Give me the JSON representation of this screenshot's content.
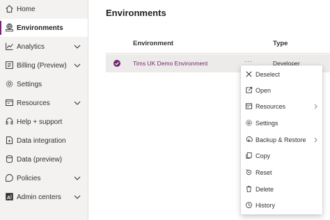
{
  "sidebar": {
    "items": [
      {
        "label": "Home",
        "icon": "home-icon"
      },
      {
        "label": "Environments",
        "icon": "environments-icon",
        "active": true
      },
      {
        "label": "Analytics",
        "icon": "analytics-icon",
        "expandable": true
      },
      {
        "label": "Billing (Preview)",
        "icon": "billing-icon",
        "expandable": true
      },
      {
        "label": "Settings",
        "icon": "gear-icon"
      },
      {
        "label": "Resources",
        "icon": "resources-icon",
        "expandable": true
      },
      {
        "label": "Help + support",
        "icon": "headset-icon"
      },
      {
        "label": "Data integration",
        "icon": "data-integration-icon"
      },
      {
        "label": "Data (preview)",
        "icon": "database-icon"
      },
      {
        "label": "Policies",
        "icon": "policies-icon",
        "expandable": true
      },
      {
        "label": "Admin centers",
        "icon": "admin-centers-icon",
        "expandable": true
      }
    ]
  },
  "main": {
    "title": "Environments",
    "table": {
      "columns": [
        "Environment",
        "Type"
      ],
      "rows": [
        {
          "environment": "Tims UK Demo Environment",
          "more": "···",
          "type": "Developer",
          "selected": true
        }
      ]
    }
  },
  "context_menu": {
    "items": [
      {
        "label": "Deselect",
        "icon": "close-icon"
      },
      {
        "label": "Open",
        "icon": "open-icon"
      },
      {
        "label": "Resources",
        "icon": "resources-icon",
        "submenu": true
      },
      {
        "label": "Settings",
        "icon": "gear-icon"
      },
      {
        "label": "Backup & Restore",
        "icon": "backup-icon",
        "submenu": true
      },
      {
        "label": "Copy",
        "icon": "copy-icon"
      },
      {
        "label": "Reset",
        "icon": "reset-icon"
      },
      {
        "label": "Delete",
        "icon": "delete-icon"
      },
      {
        "label": "History",
        "icon": "history-icon"
      }
    ]
  },
  "colors": {
    "accent": "#742774",
    "sidebar_bg": "#f3f2f1",
    "selected_row_bg": "#edebe9"
  }
}
